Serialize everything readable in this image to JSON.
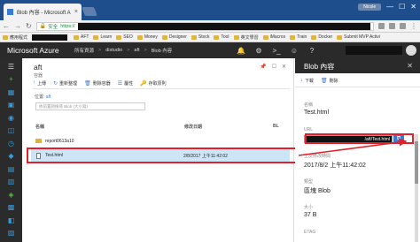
{
  "browser": {
    "tab_title": "Blob 內容 - Microsoft A",
    "tab_close": "×",
    "profile": "Nicole",
    "window_min": "—",
    "window_max": "☐",
    "window_close": "✕",
    "back": "←",
    "forward": "→",
    "reload": "↻",
    "secure_label": "安全",
    "url_scheme": "https://",
    "menu": "⋮"
  },
  "bookmarks": [
    {
      "label": "應用程式",
      "kind": "app"
    },
    {
      "label": "",
      "kind": "redact"
    },
    {
      "label": "AFT",
      "kind": "folder"
    },
    {
      "label": "Learn",
      "kind": "folder"
    },
    {
      "label": "SEO",
      "kind": "folder"
    },
    {
      "label": "Money",
      "kind": "folder"
    },
    {
      "label": "Designer",
      "kind": "folder"
    },
    {
      "label": "Stock",
      "kind": "folder"
    },
    {
      "label": "Tool",
      "kind": "folder"
    },
    {
      "label": "英文學習",
      "kind": "folder"
    },
    {
      "label": "iMacros",
      "kind": "folder"
    },
    {
      "label": "Train",
      "kind": "folder"
    },
    {
      "label": "Docker",
      "kind": "folder"
    },
    {
      "label": "Submit MVP Activi",
      "kind": "folder"
    }
  ],
  "azure": {
    "brand": "Microsoft Azure",
    "breadcrumbs": [
      "所有資源",
      "distudio",
      "aft",
      "Blob 內容"
    ],
    "breadcrumb_sep": ">",
    "tools": [
      "🔔",
      "⚙",
      ">_",
      "☺",
      "?"
    ]
  },
  "rail": {
    "icons": [
      {
        "glyph": "☰",
        "color": "#dddddd"
      },
      {
        "glyph": "+",
        "color": "#5fb54a"
      },
      {
        "glyph": "▦",
        "color": "#3a9ad9"
      },
      {
        "glyph": "▣",
        "color": "#3a9ad9"
      },
      {
        "glyph": "◉",
        "color": "#3a9ad9"
      },
      {
        "glyph": "◫",
        "color": "#3a9ad9"
      },
      {
        "glyph": "◷",
        "color": "#3a9ad9"
      },
      {
        "glyph": "◆",
        "color": "#3a9ad9"
      },
      {
        "glyph": "▤",
        "color": "#3a9ad9"
      },
      {
        "glyph": "▥",
        "color": "#3a9ad9"
      },
      {
        "glyph": "◈",
        "color": "#5fb54a"
      },
      {
        "glyph": "▩",
        "color": "#3a9ad9"
      },
      {
        "glyph": "◧",
        "color": "#3a9ad9"
      },
      {
        "glyph": "▧",
        "color": "#3a9ad9"
      }
    ]
  },
  "container_blade": {
    "title": "aft",
    "subtitle": "容器",
    "pin": "📌",
    "maximize": "☐",
    "close": "✕",
    "toolbar": [
      {
        "icon": "↑",
        "label": "上傳"
      },
      {
        "icon": "↻",
        "label": "重新整理"
      },
      {
        "icon": "🗑",
        "label": "刪除容器"
      },
      {
        "icon": "☰",
        "label": "屬性"
      },
      {
        "icon": "🔑",
        "label": "存取原則"
      }
    ],
    "location_label": "位置:",
    "location_value": "aft",
    "search_placeholder": "依前置詞搜尋 Blob (大小寫)",
    "columns": [
      "名稱",
      "修改日期",
      "BL"
    ],
    "rows": [
      {
        "name": "report0613a10",
        "modified": "",
        "type": "folder"
      },
      {
        "name": "Test.html",
        "modified": "2/8/2017 上午11:42:02",
        "type": "file",
        "selected": true
      }
    ]
  },
  "blob_blade": {
    "title": "Blob 內容",
    "pin": "📌",
    "close": "✕",
    "toolbar": [
      {
        "icon": "↓",
        "label": "下載"
      },
      {
        "icon": "🗑",
        "label": "刪除"
      }
    ],
    "props": [
      {
        "label": "名稱",
        "value": "Test.html"
      },
      {
        "label": "URL",
        "value": "/aft/Test.html"
      },
      {
        "label": "上次修改時間",
        "value": "2017/8/2 上午11:42:02"
      },
      {
        "label": "類型",
        "value": "區塊 Blob"
      },
      {
        "label": "大小",
        "value": "37 B"
      },
      {
        "label": "ETAG",
        "value": ""
      }
    ],
    "copy_icon": "⧉"
  }
}
